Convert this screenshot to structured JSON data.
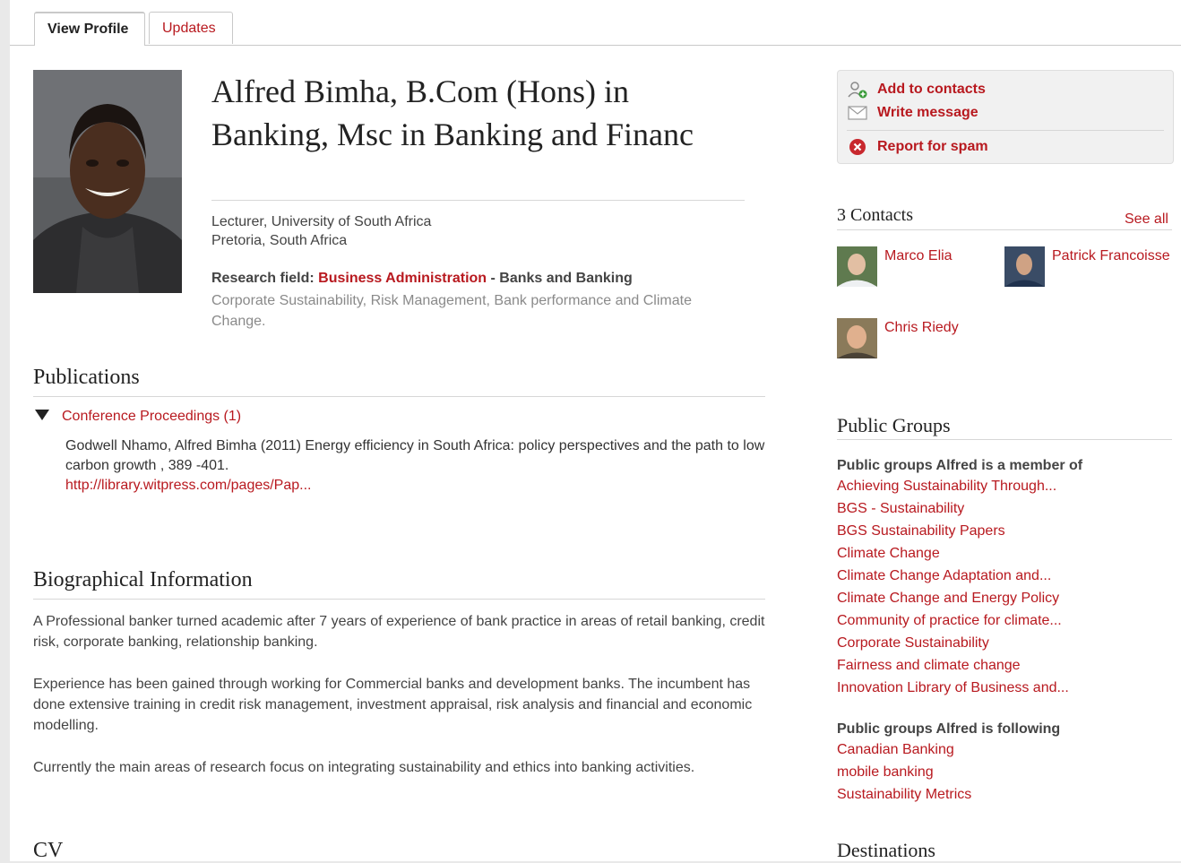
{
  "tabs": {
    "view_profile": "View Profile",
    "updates": "Updates"
  },
  "profile": {
    "name": "Alfred Bimha, B.Com (Hons) in Banking, Msc in Banking and Financ",
    "position": "Lecturer, University of South Africa",
    "location": "Pretoria, South Africa",
    "research_field_label": "Research field:",
    "research_field_link": "Business Administration",
    "research_field_sub": " - Banks and Banking",
    "keywords": "Corporate Sustainability, Risk Management, Bank performance and Climate Change."
  },
  "publications": {
    "title": "Publications",
    "category": "Conference Proceedings (1)",
    "entry_authors": "Godwell Nhamo, Alfred Bimha (2011) Energy efficiency in South Africa: policy perspectives and the path to low carbon growth , 389 -401.",
    "entry_link": "http://library.witpress.com/pages/Pap..."
  },
  "bio": {
    "title": "Biographical Information",
    "p1": "A Professional banker turned academic after 7 years of experience of bank practice in areas of retail banking, credit risk, corporate banking, relationship banking.",
    "p2": "Experience has been gained through working for Commercial banks and development banks. The incumbent has done extensive training in credit risk management, investment appraisal, risk analysis and financial and economic modelling.",
    "p3": "Currently the main areas of research focus on integrating sustainability and ethics into banking activities."
  },
  "cv": {
    "title": "CV"
  },
  "actions": {
    "add_contact": "Add to contacts",
    "write_message": "Write message",
    "report_spam": "Report for spam"
  },
  "contacts": {
    "title": "3 Contacts",
    "see_all": "See all",
    "people": [
      "Marco Elia",
      "Patrick Francoisse",
      "Chris Riedy"
    ]
  },
  "groups": {
    "title": "Public Groups",
    "member_heading": "Public groups Alfred is a member of",
    "member_of": [
      "Achieving Sustainability Through...",
      "BGS - Sustainability",
      "BGS Sustainability Papers",
      "Climate Change",
      "Climate Change Adaptation and...",
      "Climate Change and Energy Policy",
      "Community of practice for climate...",
      "Corporate Sustainability",
      "Fairness and climate change",
      "Innovation Library of Business and..."
    ],
    "following_heading": "Public groups Alfred is following",
    "following": [
      "Canadian Banking",
      "mobile banking",
      "Sustainability Metrics"
    ]
  },
  "destinations": {
    "title": "Destinations"
  },
  "colors": {
    "accent": "#b8191f",
    "text": "#333333",
    "muted": "#8a8a8a"
  }
}
